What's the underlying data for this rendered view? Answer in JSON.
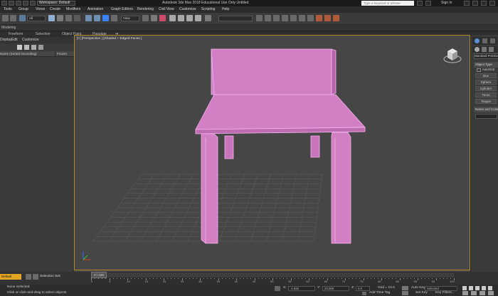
{
  "titlebar": {
    "workspace": "Workspace: Default",
    "app_title": "Autodesk 3ds Max 2018   Educational Use Only   Untitled",
    "search_placeholder": "Type a keyword or phrase",
    "sign_in": "Sign In"
  },
  "menu": [
    "Tools",
    "Group",
    "Views",
    "Create",
    "Modifiers",
    "Animation",
    "Graph Editors",
    "Rendering",
    "Civil View",
    "Customize",
    "Scripting",
    "Help"
  ],
  "toolbar": {
    "filter_select": "All",
    "coord_select": "View"
  },
  "ribbon": {
    "label": "Modeling",
    "tabs": [
      "Freeform",
      "Selection",
      "Object Paint",
      "Populate"
    ]
  },
  "scene_explorer": {
    "menu": [
      "Display",
      "Edit",
      "Customize"
    ],
    "col_name": "Name (Sorted Ascending)",
    "col_frozen": "Frozen"
  },
  "viewport": {
    "label": "[+] [Perspective ] [Shaded + Edged Faces ]"
  },
  "command_panel": {
    "dropdown": "Standard Primitives",
    "rollout_object": "Object Type",
    "autogrid": "AutoGrid",
    "buttons": [
      "Box",
      "Sphere",
      "Cylinder",
      "Torus",
      "Teapot"
    ],
    "rollout_name": "Name and Color"
  },
  "timeline": {
    "slider": "0 / 100",
    "ticks": [
      "0",
      "5",
      "10",
      "15",
      "20",
      "25",
      "30",
      "35",
      "40",
      "45",
      "50",
      "55",
      "60",
      "65",
      "70",
      "75",
      "80",
      "85",
      "90",
      "95",
      "100"
    ]
  },
  "status": {
    "default_label": "Default",
    "selection_set": "Selection Set:",
    "none_selected": "None Selected",
    "prompt": "Click or click-and-drag to select objects",
    "x_value": "-1.842",
    "y_value": "23.069",
    "z_value": "0.0",
    "grid": "Grid = 10.0",
    "add_time_tag": "Add Time Tag",
    "auto_key": "Auto Key",
    "selected": "Selected",
    "set_key": "Set Key",
    "key_filters": "Key Filters..."
  },
  "colors": {
    "chair": "#d27fc4",
    "chair_edge": "#f5b3ee",
    "viewport_bg": "#464646",
    "active_border": "#b58a2a",
    "default_badge": "#e3a422"
  }
}
